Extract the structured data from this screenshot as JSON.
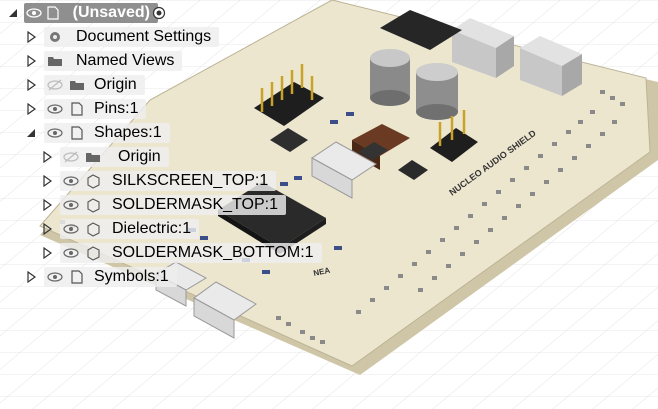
{
  "browser": {
    "root": {
      "label": "(Unsaved)"
    },
    "items": [
      {
        "label": "Document Settings",
        "icon": "gear-icon"
      },
      {
        "label": "Named Views",
        "icon": "folder-icon"
      },
      {
        "label": "Origin",
        "icon": "folder-icon",
        "hidden": true
      },
      {
        "label": "Pins:1",
        "icon": "component-icon"
      },
      {
        "label": "Shapes:1",
        "icon": "component-icon",
        "expanded": true
      },
      {
        "label": "Origin",
        "icon": "folder-icon",
        "hidden": true
      },
      {
        "label": "SILKSCREEN_TOP:1",
        "icon": "body-icon"
      },
      {
        "label": "SOLDERMASK_TOP:1",
        "icon": "body-icon"
      },
      {
        "label": "Dielectric:1",
        "icon": "body-icon"
      },
      {
        "label": "SOLDERMASK_BOTTOM:1",
        "icon": "body-icon"
      },
      {
        "label": "Symbols:1",
        "icon": "component-icon"
      }
    ]
  },
  "board": {
    "silkscreen_title": "NUCLEO AUDIO SHIELD",
    "silkscreen_logo": "NEA",
    "colors": {
      "board": "#ece6cf",
      "board_edge": "#bdb395",
      "grid": "#d2d2d2",
      "pads": "#8a8a8a",
      "chip": "#2a2a2a"
    }
  }
}
